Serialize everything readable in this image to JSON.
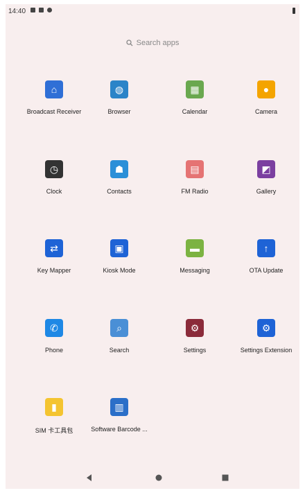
{
  "status_bar": {
    "time": "14:40",
    "icons": [
      "notification-icon",
      "notification-icon",
      "settings-gear-icon"
    ],
    "battery": "battery-icon"
  },
  "search": {
    "placeholder": "Search apps"
  },
  "apps": [
    {
      "label": "Broadcast Receiver",
      "icon": "broadcast-icon",
      "color": "#2f6fd6"
    },
    {
      "label": "Browser",
      "icon": "globe-icon",
      "color": "#2b84c8"
    },
    {
      "label": "Calendar",
      "icon": "calendar-icon",
      "color": "#6aa84f"
    },
    {
      "label": "Camera",
      "icon": "camera-icon",
      "color": "#f4a400"
    },
    {
      "label": "Clock",
      "icon": "clock-icon",
      "color": "#333333"
    },
    {
      "label": "Contacts",
      "icon": "contacts-icon",
      "color": "#2b8fd8"
    },
    {
      "label": "FM Radio",
      "icon": "radio-icon",
      "color": "#e57373"
    },
    {
      "label": "Gallery",
      "icon": "gallery-icon",
      "color": "#7b3fa0"
    },
    {
      "label": "Key Mapper",
      "icon": "key-mapper-icon",
      "color": "#1e63d6"
    },
    {
      "label": "Kiosk Mode",
      "icon": "lock-icon",
      "color": "#1e63d6"
    },
    {
      "label": "Messaging",
      "icon": "message-icon",
      "color": "#7cb342"
    },
    {
      "label": "OTA Update",
      "icon": "upload-arrow-icon",
      "color": "#1e63d6"
    },
    {
      "label": "Phone",
      "icon": "phone-icon",
      "color": "#1e88e5"
    },
    {
      "label": "Search",
      "icon": "magnifier-icon",
      "color": "#4a8fd6"
    },
    {
      "label": "Settings",
      "icon": "gear-icon",
      "color": "#8b2b3a"
    },
    {
      "label": "Settings Extension",
      "icon": "gear-icon",
      "color": "#1e63d6"
    },
    {
      "label": "SIM 卡工具包",
      "icon": "sim-toolkit-icon",
      "color": "#f4c430"
    },
    {
      "label": "Software Barcode ...",
      "icon": "barcode-icon",
      "color": "#2b6fc8"
    }
  ],
  "nav": {
    "back": "back-icon",
    "home": "home-icon",
    "recents": "recents-icon"
  }
}
